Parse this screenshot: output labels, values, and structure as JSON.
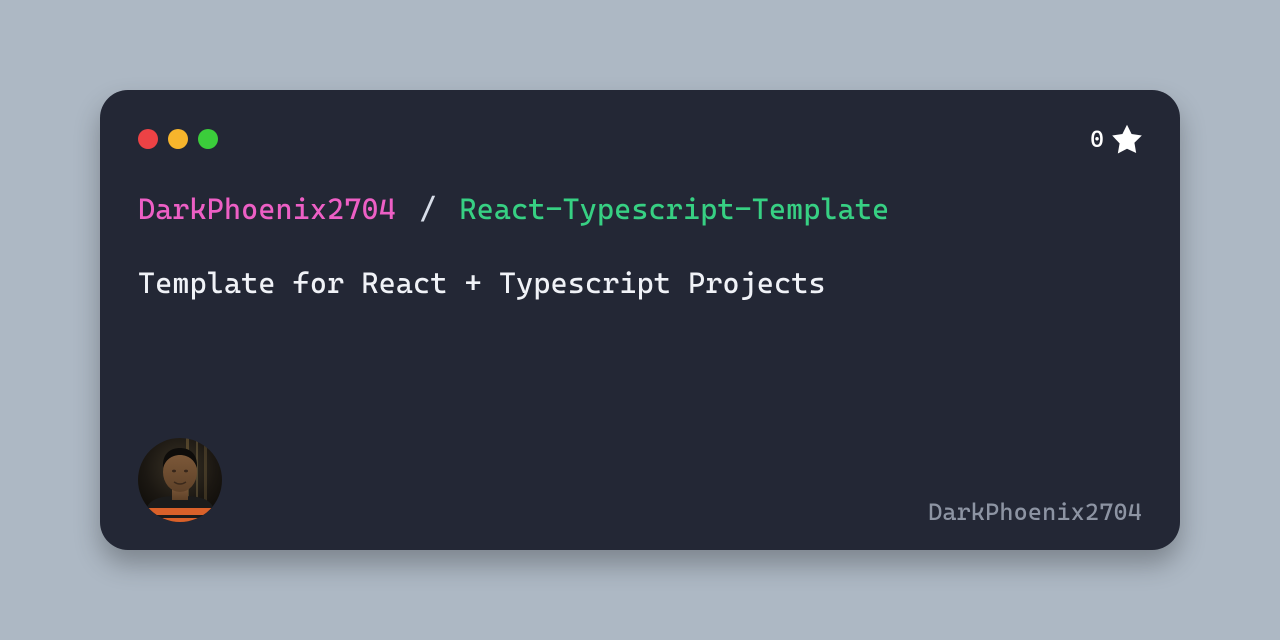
{
  "card": {
    "traffic_lights": {
      "red": "#ed4245",
      "yellow": "#f7b52c",
      "green": "#3bcd3b"
    },
    "stars": {
      "count": "0"
    },
    "repo": {
      "owner": "DarkPhoenix2704",
      "separator": "/",
      "name": "React-Typescript-Template"
    },
    "description": "Template for React + Typescript Projects",
    "username": "DarkPhoenix2704"
  }
}
